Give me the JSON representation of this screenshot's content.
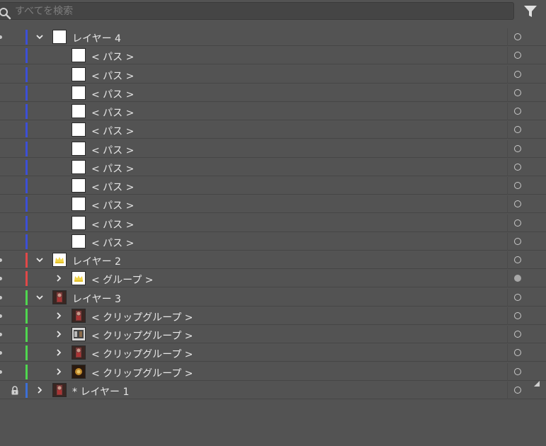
{
  "search": {
    "placeholder": "すべてを検索"
  },
  "icons": {
    "search": "search-icon",
    "filter": "filter-icon",
    "expand": "chevron-down-icon",
    "collapse": "chevron-right-icon",
    "lock": "lock-icon",
    "target": "target-circle-icon"
  },
  "colors": {
    "layer4": "#3c4fd6",
    "layer2": "#e04848",
    "layer3": "#4fd64f",
    "layer1": "#3c6fd6"
  },
  "rows": [
    {
      "label": "レイヤー 4",
      "level": 0,
      "expander": "down",
      "color": "#3c4fd6",
      "thumb": "white",
      "target": "empty",
      "vis": true
    },
    {
      "label": "< パス >",
      "level": 1,
      "expander": "none",
      "color": "#3c4fd6",
      "thumb": "white",
      "target": "empty",
      "vis": false
    },
    {
      "label": "< パス >",
      "level": 1,
      "expander": "none",
      "color": "#3c4fd6",
      "thumb": "white",
      "target": "empty",
      "vis": false
    },
    {
      "label": "< パス >",
      "level": 1,
      "expander": "none",
      "color": "#3c4fd6",
      "thumb": "white",
      "target": "empty",
      "vis": false
    },
    {
      "label": "< パス >",
      "level": 1,
      "expander": "none",
      "color": "#3c4fd6",
      "thumb": "white",
      "target": "empty",
      "vis": false
    },
    {
      "label": "< パス >",
      "level": 1,
      "expander": "none",
      "color": "#3c4fd6",
      "thumb": "white",
      "target": "empty",
      "vis": false
    },
    {
      "label": "< パス >",
      "level": 1,
      "expander": "none",
      "color": "#3c4fd6",
      "thumb": "white",
      "target": "empty",
      "vis": false
    },
    {
      "label": "< パス >",
      "level": 1,
      "expander": "none",
      "color": "#3c4fd6",
      "thumb": "white",
      "target": "empty",
      "vis": false
    },
    {
      "label": "< パス >",
      "level": 1,
      "expander": "none",
      "color": "#3c4fd6",
      "thumb": "white",
      "target": "empty",
      "vis": false
    },
    {
      "label": "< パス >",
      "level": 1,
      "expander": "none",
      "color": "#3c4fd6",
      "thumb": "white",
      "target": "empty",
      "vis": false
    },
    {
      "label": "< パス >",
      "level": 1,
      "expander": "none",
      "color": "#3c4fd6",
      "thumb": "white",
      "target": "empty",
      "vis": false
    },
    {
      "label": "< パス >",
      "level": 1,
      "expander": "none",
      "color": "#3c4fd6",
      "thumb": "white",
      "target": "empty",
      "vis": false
    },
    {
      "label": "レイヤー 2",
      "level": 0,
      "expander": "down",
      "color": "#e04848",
      "thumb": "crown",
      "target": "empty",
      "vis": true
    },
    {
      "label": "< グループ >",
      "level": 1,
      "expander": "right",
      "color": "#e04848",
      "thumb": "crown",
      "target": "filled",
      "vis": true
    },
    {
      "label": "レイヤー 3",
      "level": 0,
      "expander": "down",
      "color": "#4fd64f",
      "thumb": "photo",
      "target": "empty",
      "vis": true
    },
    {
      "label": "< クリップグループ >",
      "level": 1,
      "expander": "right",
      "color": "#4fd64f",
      "thumb": "photo",
      "target": "empty",
      "vis": true
    },
    {
      "label": "< クリップグループ >",
      "level": 1,
      "expander": "right",
      "color": "#4fd64f",
      "thumb": "photo2",
      "target": "empty",
      "vis": true
    },
    {
      "label": "< クリップグループ >",
      "level": 1,
      "expander": "right",
      "color": "#4fd64f",
      "thumb": "photo",
      "target": "empty",
      "vis": true
    },
    {
      "label": "< クリップグループ >",
      "level": 1,
      "expander": "right",
      "color": "#4fd64f",
      "thumb": "photo3",
      "target": "empty",
      "vis": true
    },
    {
      "label": "* レイヤー 1",
      "level": 0,
      "expander": "right",
      "color": "#3c6fd6",
      "thumb": "photo",
      "target": "empty",
      "vis": false,
      "locked": true
    }
  ]
}
